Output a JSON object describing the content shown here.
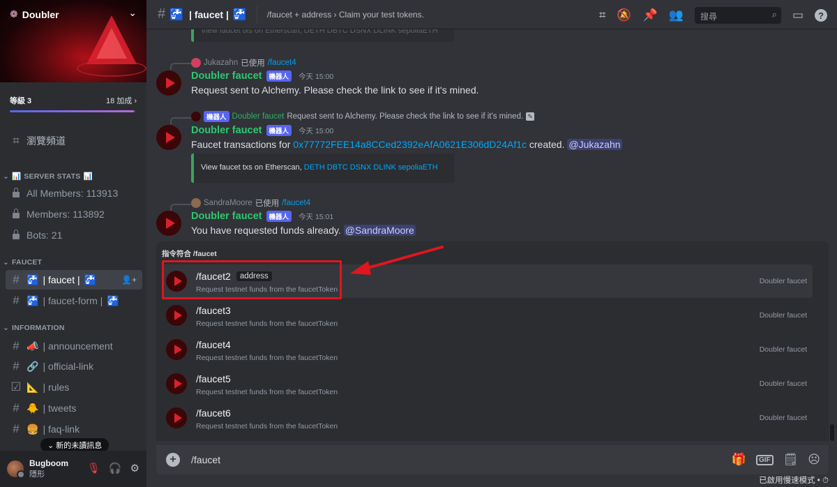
{
  "server": {
    "name": "Doubler",
    "level_label": "等級 3",
    "boost_label": "18 加成",
    "boost_progress": 0.99,
    "browse_channels": "瀏覽頻道"
  },
  "sidebar": {
    "server_stats_category": "SERVER STATS",
    "stats": [
      {
        "label": "All Members: 113913"
      },
      {
        "label": "Members: 113892"
      },
      {
        "label": "Bots: 21"
      }
    ],
    "faucet_category": "FAUCET",
    "faucet_channels": [
      {
        "label": "| faucet |",
        "active": true
      },
      {
        "label": "| faucet-form |",
        "active": false
      }
    ],
    "information_category": "INFORMATION",
    "info_channels": [
      {
        "label": "| announcement"
      },
      {
        "label": "| official-link"
      },
      {
        "label": "| rules"
      },
      {
        "label": "| tweets"
      },
      {
        "label": "| faq-link"
      }
    ],
    "new_unread": "新的未讀訊息"
  },
  "user": {
    "name": "Bugboom",
    "status": "隱形"
  },
  "header": {
    "channel": "| faucet |",
    "topic": "/faucet + address › Claim your test tokens.",
    "search_placeholder": "搜尋"
  },
  "messages": {
    "top_embed_fragment": "View faucet txs on Etherscan, DETH DBTC DSNX DLINK sepoliaETH",
    "m1": {
      "reply_user": "Jukazahn",
      "reply_used": "已使用",
      "reply_cmd": "/faucet4",
      "author": "Doubler faucet",
      "bot_tag": "機器人",
      "time": "今天 15:00",
      "text": "Request sent to Alchemy. Please check the link to see if it's mined."
    },
    "m2": {
      "reply_tag": "機器人",
      "reply_user": "Doubler faucet",
      "reply_text": "Request sent to Alchemy. Please check the link to see if it's mined.",
      "author": "Doubler faucet",
      "bot_tag": "機器人",
      "time": "今天 15:00",
      "text_prefix": "Faucet transactions for ",
      "address": "0x77772FEE14a8CCed2392eAfA0621E306dD24Af1c",
      "text_mid": " created. ",
      "mention": "@Jukazahn",
      "embed_prefix": "View faucet txs on Etherscan, ",
      "embed_links": "DETH DBTC DSNX DLINK sepoliaETH"
    },
    "m3": {
      "reply_user": "SandraMoore",
      "reply_used": "已使用",
      "reply_cmd": "/faucet4",
      "author": "Doubler faucet",
      "bot_tag": "機器人",
      "time": "今天 15:01",
      "text": "You have requested funds already. ",
      "mention": "@SandraMoore"
    }
  },
  "autocomplete": {
    "heading": "指令符合 /faucet",
    "items": [
      {
        "name": "/faucet2",
        "option": "address",
        "desc": "Request testnet funds from the faucetToken",
        "source": "Doubler faucet"
      },
      {
        "name": "/faucet3",
        "desc": "Request testnet funds from the faucetToken",
        "source": "Doubler faucet"
      },
      {
        "name": "/faucet4",
        "desc": "Request testnet funds from the faucetToken",
        "source": "Doubler faucet"
      },
      {
        "name": "/faucet5",
        "desc": "Request testnet funds from the faucetToken",
        "source": "Doubler faucet"
      },
      {
        "name": "/faucet6",
        "desc": "Request testnet funds from the faucetToken",
        "source": "Doubler faucet"
      }
    ]
  },
  "composer": {
    "value": "/faucet",
    "slowmode": "已啟用慢速模式 •"
  },
  "colors": {
    "accent": "#5865f2",
    "bot_name": "#2dc770",
    "link": "#00a8fc",
    "highlight": "#e0161e"
  }
}
